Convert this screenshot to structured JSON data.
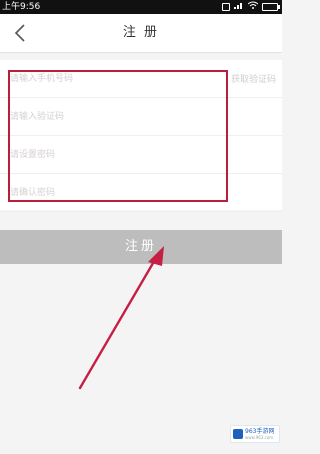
{
  "status_bar": {
    "time": "上午9:56",
    "icons": [
      "alarm-icon",
      "signal-icon",
      "wifi-icon",
      "battery-icon"
    ]
  },
  "header": {
    "title": "注 册",
    "back_icon": "chevron-left-icon"
  },
  "form": {
    "fields": [
      {
        "placeholder": "请输入手机号码"
      },
      {
        "placeholder": "请输入验证码"
      },
      {
        "placeholder": "请设置密码"
      },
      {
        "placeholder": "请确认密码"
      }
    ],
    "send_code_label": "获取验证码"
  },
  "register_button": {
    "label": "注册"
  },
  "watermark": {
    "text": "963手游网",
    "subtext": "www.963.com"
  },
  "colors": {
    "highlight": "#b81e3a",
    "arrow": "#c51f45",
    "button_bg": "#bdbdbd",
    "watermark_blue": "#1e5fbf"
  }
}
